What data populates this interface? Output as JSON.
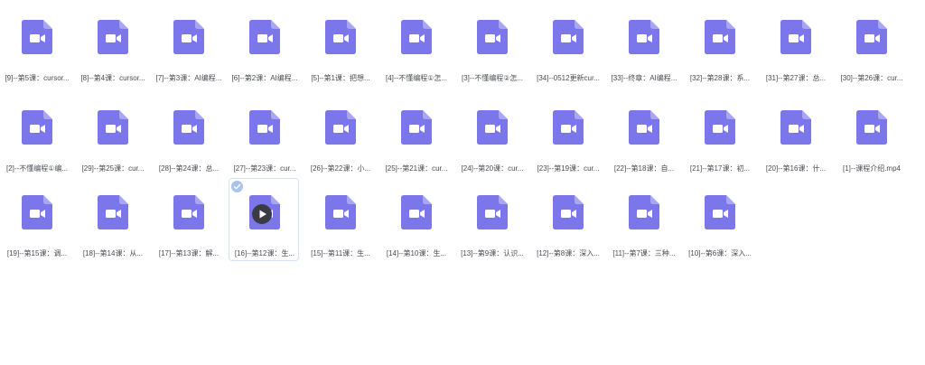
{
  "colors": {
    "file_icon": "#7b77ea",
    "file_fold": "#a9a6f3",
    "camera": "#ffffff",
    "label": "#4a4d55",
    "selected_border": "#d4e3f7",
    "play_badge": "#3b3b44",
    "check_badge": "#a9c4ea"
  },
  "icons": {
    "file": "video-file-icon",
    "play": "play-icon",
    "check": "check-icon"
  },
  "files": {
    "row1": [
      {
        "name": "[9]--第5课：cursor..."
      },
      {
        "name": "[8]--第4课：cursor..."
      },
      {
        "name": "[7]--第3课：AI编程..."
      },
      {
        "name": "[6]--第2课：AI编程..."
      },
      {
        "name": "[5]--第1课：把想..."
      },
      {
        "name": "[4]--不懂编程①怎..."
      },
      {
        "name": "[3]--不懂编程②怎..."
      },
      {
        "name": "[34]--0512更新cur..."
      },
      {
        "name": "[33]--终章：AI编程..."
      },
      {
        "name": "[32]--第28课：系..."
      },
      {
        "name": "[31]--第27课：总..."
      },
      {
        "name": "[30]--第26课：cur..."
      }
    ],
    "row2": [
      {
        "name": "[2]--不懂编程①编..."
      },
      {
        "name": "[29]--第25课：cur..."
      },
      {
        "name": "[28]--第24课：总..."
      },
      {
        "name": "[27]--第23课：cur..."
      },
      {
        "name": "[26]--第22课：小..."
      },
      {
        "name": "[25]--第21课：cur..."
      },
      {
        "name": "[24]--第20课：cur..."
      },
      {
        "name": "[23]--第19课：cur..."
      },
      {
        "name": "[22]--第18课：自..."
      },
      {
        "name": "[21]--第17课：初..."
      },
      {
        "name": "[20]--第16课：什..."
      },
      {
        "name": "[1]--课程介绍.mp4"
      }
    ],
    "row3": [
      {
        "name": "[19]--第15课：调..."
      },
      {
        "name": "[18]--第14课：从..."
      },
      {
        "name": "[17]--第13课：解..."
      },
      {
        "name": "[16]--第12课：生...",
        "selected": true
      },
      {
        "name": "[15]--第11课：生..."
      },
      {
        "name": "[14]--第10课：生..."
      },
      {
        "name": "[13]--第9课：认识..."
      },
      {
        "name": "[12]--第8课：深入..."
      },
      {
        "name": "[11]--第7课：三种..."
      },
      {
        "name": "[10]--第6课：深入..."
      }
    ]
  }
}
